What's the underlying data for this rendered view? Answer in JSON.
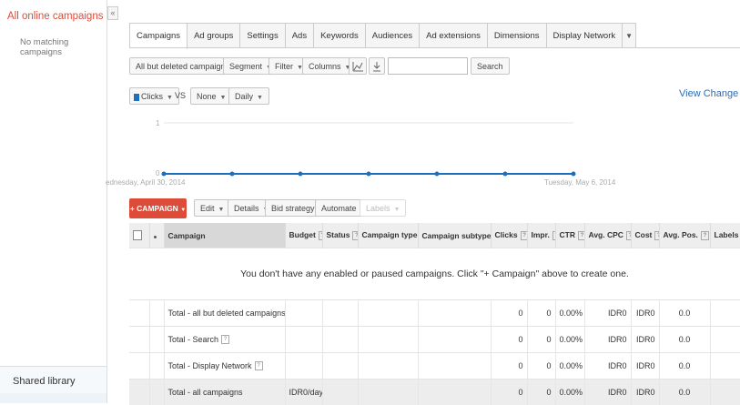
{
  "sidebar": {
    "title": "All online campaigns",
    "empty_text": "No matching campaigns",
    "shared_library": "Shared library",
    "collapse_glyph": "«"
  },
  "tabs": [
    "Campaigns",
    "Ad groups",
    "Settings",
    "Ads",
    "Keywords",
    "Audiences",
    "Ad extensions",
    "Dimensions",
    "Display Network"
  ],
  "tab_more": "▼",
  "toolbar": {
    "filter_campaigns": "All but deleted campaigns",
    "segment": "Segment",
    "filter": "Filter",
    "columns": "Columns",
    "search_button": "Search",
    "search_value": ""
  },
  "chart_controls": {
    "metric1": "Clicks",
    "vs": "VS",
    "metric2": "None",
    "period": "Daily"
  },
  "view_history": "View Change Histor",
  "chart": {
    "y_top": "1",
    "y_bottom": "0",
    "start_date": "ednesday, April 30, 2014",
    "end_date": "Tuesday, May 6, 2014",
    "points": [
      0,
      0,
      0,
      0,
      0,
      0,
      0
    ]
  },
  "actions": {
    "add_campaign": "+ CAMPAIGN",
    "edit": "Edit",
    "details": "Details",
    "bid_strategy": "Bid strategy",
    "automate": "Automate",
    "labels": "Labels"
  },
  "table": {
    "headers": {
      "campaign": "Campaign",
      "budget": "Budget",
      "status": "Status",
      "campaign_type": "Campaign type",
      "campaign_subtype": "Campaign subtype",
      "clicks": "Clicks",
      "impr": "Impr.",
      "ctr": "CTR",
      "avg_cpc": "Avg. CPC",
      "cost": "Cost",
      "avg_pos": "Avg. Pos.",
      "labels": "Labels"
    },
    "empty_message": "You don't have any enabled or paused campaigns. Click \"+ Campaign\" above to create one.",
    "totals": [
      {
        "label": "Total - all but deleted campaigns",
        "budget": "",
        "clicks": "0",
        "impr": "0",
        "ctr": "0.00%",
        "avg_cpc": "IDR0",
        "cost": "IDR0",
        "avg_pos": "0.0",
        "help": false
      },
      {
        "label": "Total - Search",
        "budget": "",
        "clicks": "0",
        "impr": "0",
        "ctr": "0.00%",
        "avg_cpc": "IDR0",
        "cost": "IDR0",
        "avg_pos": "0.0",
        "help": true
      },
      {
        "label": "Total - Display Network",
        "budget": "",
        "clicks": "0",
        "impr": "0",
        "ctr": "0.00%",
        "avg_cpc": "IDR0",
        "cost": "IDR0",
        "avg_pos": "0.0",
        "help": true
      },
      {
        "label": "Total - all campaigns",
        "budget": "IDR0/day",
        "clicks": "0",
        "impr": "0",
        "ctr": "0.00%",
        "avg_cpc": "IDR0",
        "cost": "IDR0",
        "avg_pos": "0.0",
        "help": false
      }
    ]
  },
  "colors": {
    "accent_red": "#dd4b39",
    "link_blue": "#2a6bb8",
    "series_blue": "#1f6fbf"
  }
}
